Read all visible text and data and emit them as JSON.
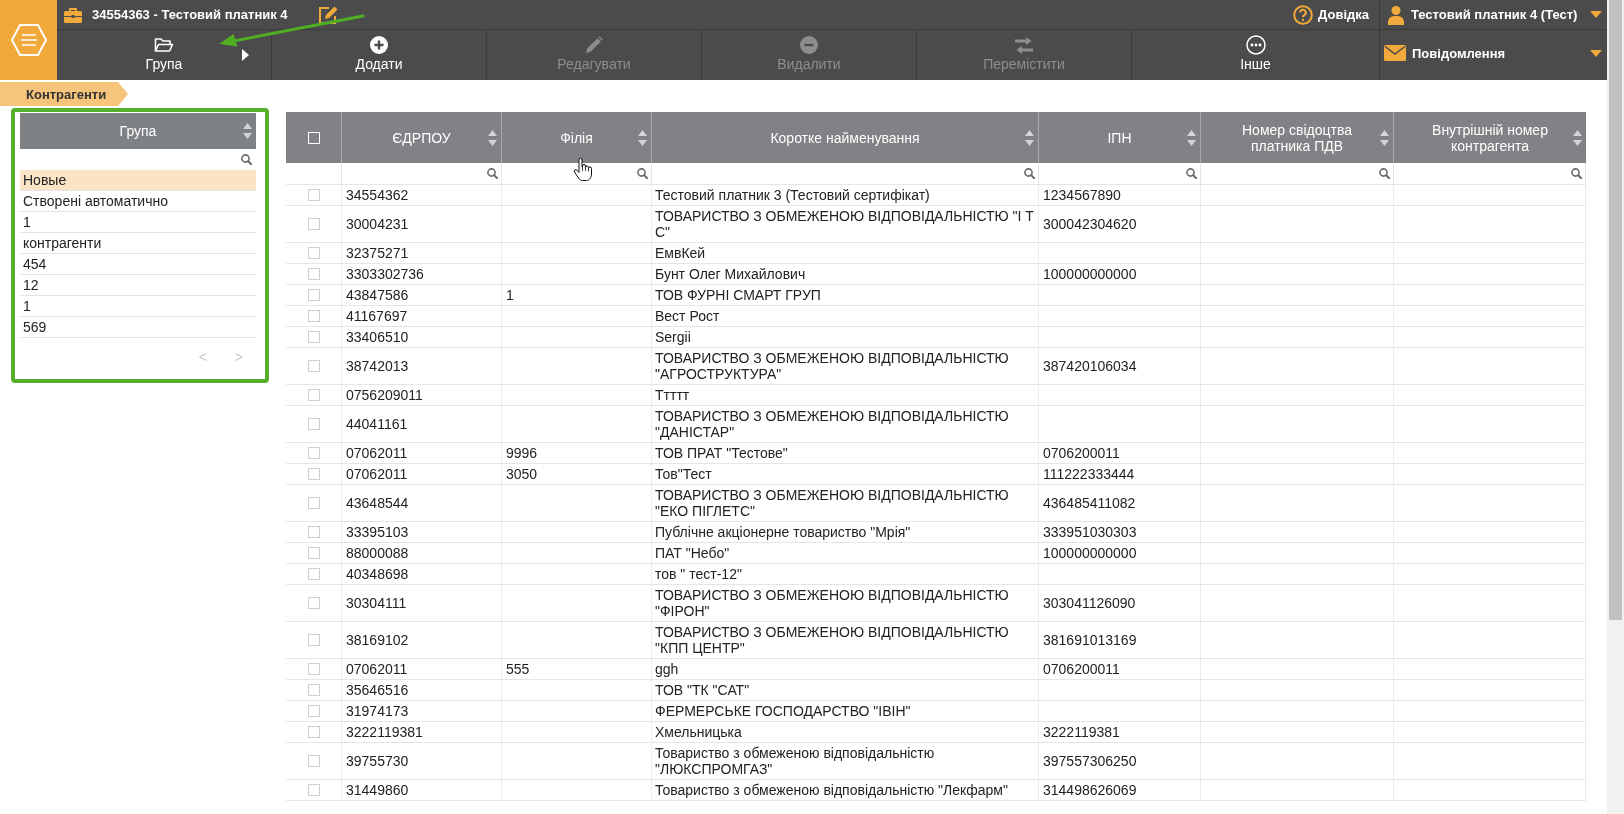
{
  "title_bar": {
    "title": "34554363 - Тестовий платник 4",
    "help": "Довідка",
    "user": "Тестовий платник 4 (Тест)"
  },
  "toolbar": {
    "buttons": [
      {
        "kind": "group",
        "label": "Група",
        "disabled": false
      },
      {
        "kind": "add",
        "label": "Додати",
        "disabled": false
      },
      {
        "kind": "edit",
        "label": "Редагувати",
        "disabled": true
      },
      {
        "kind": "delete",
        "label": "Видалити",
        "disabled": true
      },
      {
        "kind": "move",
        "label": "Перемістити",
        "disabled": true
      },
      {
        "kind": "more",
        "label": "Інше",
        "disabled": false
      }
    ]
  },
  "messages": {
    "label": "Повідомлення"
  },
  "breadcrumb": "Контрагенти",
  "group_panel": {
    "heading": "Група",
    "items": [
      {
        "label": "Новые",
        "selected": true
      },
      {
        "label": "Створені автоматично",
        "selected": false
      },
      {
        "label": "1",
        "selected": false
      },
      {
        "label": "контрагенти",
        "selected": false
      },
      {
        "label": "454",
        "selected": false
      },
      {
        "label": "12",
        "selected": false
      },
      {
        "label": "1",
        "selected": false
      },
      {
        "label": "569",
        "selected": false
      }
    ],
    "pager": {
      "previous": {
        "label": "<",
        "disabled": true
      },
      "next": {
        "label": ">",
        "disabled": true
      }
    }
  },
  "table": {
    "select_all": {
      "checked": false
    },
    "columns": [
      "ЄДРПОУ",
      "Філія",
      "Коротке найменування",
      "ІПН",
      "Номер свідоцтва платника ПДВ",
      "Внутрішній номер контрагента"
    ],
    "rows": [
      {
        "checked": false,
        "edrpou": "34554362",
        "short_name": "Тестовий платник 3 (Тестовий сертифікат)",
        "ipn": "1234567890"
      },
      {
        "checked": false,
        "edrpou": "30004231",
        "short_name": "ТОВАРИСТВО З ОБМЕЖЕНОЮ ВІДПОВІДАЛЬНІСТЮ \"І Т С\"",
        "ipn": "300042304620"
      },
      {
        "checked": false,
        "edrpou": "32375271",
        "short_name": "ЕмвКей"
      },
      {
        "checked": false,
        "edrpou": "3303302736",
        "short_name": "Бунт Олег Михайлович",
        "ipn": "100000000000"
      },
      {
        "checked": false,
        "edrpou": "43847586",
        "branch": "1",
        "short_name": "ТОВ ФУРНІ СМАРТ ГРУП"
      },
      {
        "checked": false,
        "edrpou": "41167697",
        "short_name": "Вест Рост"
      },
      {
        "checked": false,
        "edrpou": "33406510",
        "short_name": "Sergii"
      },
      {
        "checked": false,
        "edrpou": "38742013",
        "short_name": "ТОВАРИСТВО З ОБМЕЖЕНОЮ ВІДПОВІДАЛЬНІСТЮ \"АГРОСТРУКТУРА\"",
        "ipn": "387420106034"
      },
      {
        "checked": false,
        "edrpou": "0756209011",
        "short_name": "Ттттт"
      },
      {
        "checked": false,
        "edrpou": "44041161",
        "short_name": "ТОВАРИСТВО З ОБМЕЖЕНОЮ ВІДПОВІДАЛЬНІСТЮ \"ДАНІСТАР\""
      },
      {
        "checked": false,
        "edrpou": "07062011",
        "branch": "9996",
        "short_name": "ТОВ ПРАТ \"Тестове\"",
        "ipn": "0706200011"
      },
      {
        "checked": false,
        "edrpou": "07062011",
        "branch": "3050",
        "short_name": "Тов\"Тест",
        "ipn": "111222333444"
      },
      {
        "checked": false,
        "edrpou": "43648544",
        "short_name": "ТОВАРИСТВО З ОБМЕЖЕНОЮ ВІДПОВІДАЛЬНІСТЮ \"ЕКО ПІГЛЕТС\"",
        "ipn": "436485411082"
      },
      {
        "checked": false,
        "edrpou": "33395103",
        "short_name": "Публічне акціонерне товариство \"Мрія\"",
        "ipn": "333951030303"
      },
      {
        "checked": false,
        "edrpou": "88000088",
        "short_name": "ПАТ \"Небо\"",
        "ipn": "100000000000"
      },
      {
        "checked": false,
        "edrpou": "40348698",
        "short_name": "тов \" тест-12\""
      },
      {
        "checked": false,
        "edrpou": "30304111",
        "short_name": "ТОВАРИСТВО З ОБМЕЖЕНОЮ ВІДПОВІДАЛЬНІСТЮ \"ФІРОН\"",
        "ipn": "303041126090"
      },
      {
        "checked": false,
        "edrpou": "38169102",
        "short_name": "ТОВАРИСТВО З ОБМЕЖЕНОЮ ВІДПОВІДАЛЬНІСТЮ \"КПП ЦЕНТР\"",
        "ipn": "381691013169"
      },
      {
        "checked": false,
        "edrpou": "07062011",
        "branch": "555",
        "short_name": "ggh",
        "ipn": "0706200011"
      },
      {
        "checked": false,
        "edrpou": "35646516",
        "short_name": "ТОВ \"ТК \"САТ\""
      },
      {
        "checked": false,
        "edrpou": "31974173",
        "short_name": "ФЕРМЕРСЬКЕ ГОСПОДАРСТВО \"ІВІН\""
      },
      {
        "checked": false,
        "edrpou": "3222119381",
        "short_name": "Хмельницька",
        "ipn": "3222119381"
      },
      {
        "checked": false,
        "edrpou": "39755730",
        "short_name": "Товариство з обмеженою відповідальністю \"ЛЮКСПРОМГАЗ\"",
        "ipn": "397557306250"
      },
      {
        "checked": false,
        "edrpou": "31449860",
        "short_name": "Товариство з обмеженою відповідальністю \"Лекфарм\"",
        "ipn": "314498626069"
      }
    ]
  }
}
